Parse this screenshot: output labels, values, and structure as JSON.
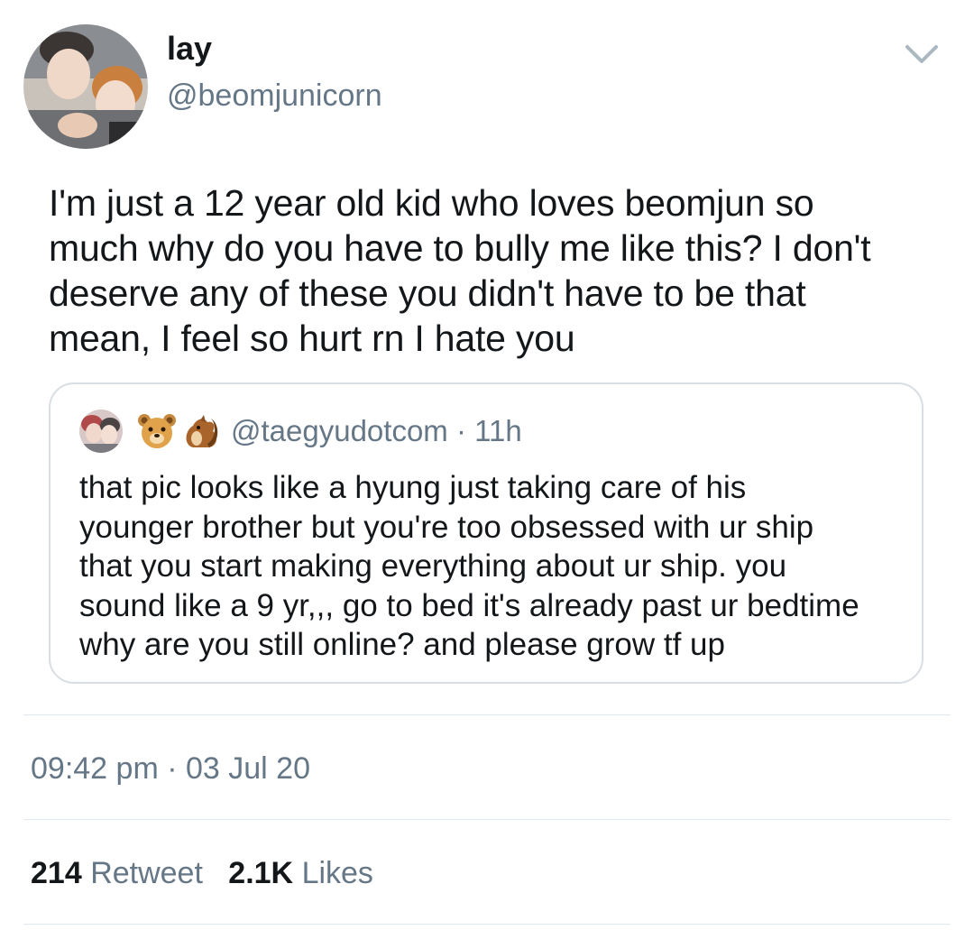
{
  "tweet": {
    "author": {
      "display_name": "lay",
      "handle": "@beomjunicorn"
    },
    "text": "I'm just a 12 year old kid who loves beomjun so\nmuch why do you have to bully me like this? I don't\ndeserve any of these you didn't have to be that\nmean, I feel so hurt rn I hate you",
    "menu_icon": "chevron-down-icon",
    "quoted": {
      "emoji": [
        "bear-face",
        "chipmunk"
      ],
      "handle": "@taegyudotcom",
      "separator": "·",
      "age": "11h",
      "text": "that pic looks like a hyung just taking care of his\nyounger brother but you're too obsessed with ur ship\nthat you start making everything about ur ship. you\nsound like a 9 yr,,, go to bed it's already past ur bedtime\nwhy are you still online? and please grow tf up"
    },
    "time": "09:42 pm",
    "date_separator": "·",
    "date": "03 Jul 20",
    "stats": {
      "retweets_count": "214",
      "retweets_label": "Retweet",
      "likes_count": "2.1K",
      "likes_label": "Likes"
    }
  },
  "colors": {
    "text_primary": "#14171a",
    "text_secondary": "#657786",
    "border": "#d9dee3"
  }
}
